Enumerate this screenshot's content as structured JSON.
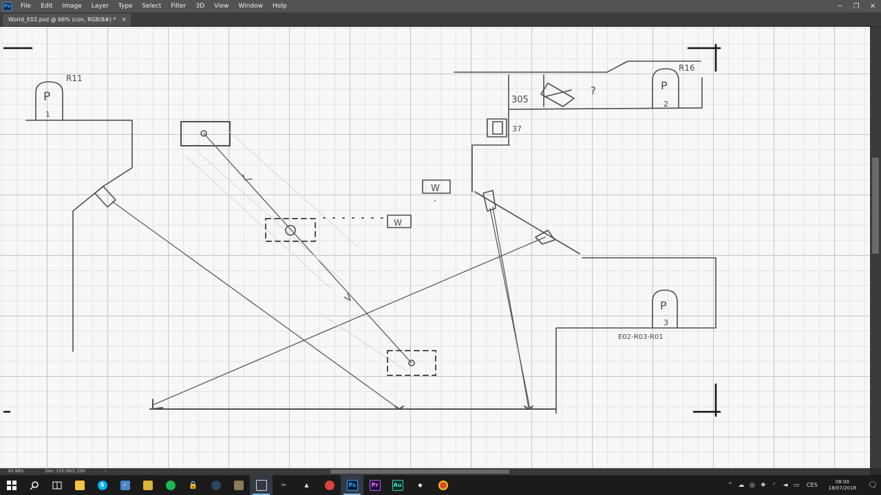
{
  "app": {
    "menu": [
      "File",
      "Edit",
      "Image",
      "Layer",
      "Type",
      "Select",
      "Filter",
      "3D",
      "View",
      "Window",
      "Help"
    ],
    "window_controls": {
      "minimize": "─",
      "restore": "❐",
      "close": "✕"
    }
  },
  "document": {
    "tab_title": "World_E02.psd @ 66% (con, RGB/8#) *",
    "close_glyph": "×"
  },
  "sketch": {
    "labels": {
      "p1_sign": "P",
      "p1_num": "1",
      "p1_tag": "R11",
      "p2_sign": "P",
      "p2_num": "2",
      "p2_tag": "R16",
      "p3_sign": "P",
      "p3_num": "3",
      "label_305": "305",
      "label_37": "37",
      "box_w1": "W",
      "box_w2": "W",
      "tag_bottom": "E02-R03-R01",
      "question": "?"
    }
  },
  "status": {
    "zoom": "65.98%",
    "doc_size": "Doc: 103.0M/1.33G",
    "arrow": "›"
  },
  "taskbar": {
    "clock_time": "08:00",
    "clock_date": "18/07/2018",
    "language": "CES",
    "notifications_glyph": "🗨"
  },
  "colors": {
    "menubar": "#535353",
    "canvas": "#f7f7f7",
    "taskbar": "#1b1b1b",
    "sketch_ink": "#4a4a4a"
  }
}
